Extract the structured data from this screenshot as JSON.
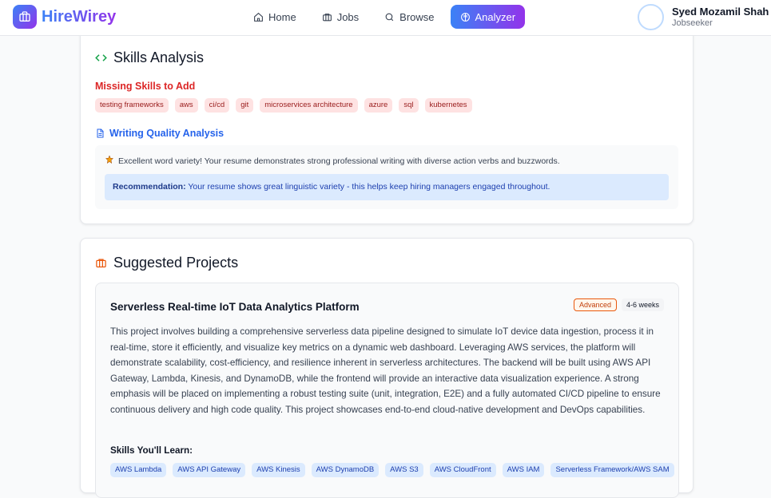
{
  "brand": {
    "name": "HireWirey"
  },
  "nav": {
    "items": [
      {
        "label": "Home",
        "icon": "home-icon"
      },
      {
        "label": "Jobs",
        "icon": "briefcase-icon"
      },
      {
        "label": "Browse",
        "icon": "search-icon"
      },
      {
        "label": "Analyzer",
        "icon": "brain-icon",
        "active": true
      }
    ]
  },
  "user": {
    "name": "Syed Mozamil Shah",
    "role": "Jobseeker"
  },
  "skills": {
    "title": "Skills Analysis",
    "missing_title": "Missing Skills to Add",
    "missing": [
      "testing frameworks",
      "aws",
      "ci/cd",
      "git",
      "microservices architecture",
      "azure",
      "sql",
      "kubernetes"
    ],
    "writing_title": "Writing Quality Analysis",
    "writing_text": "Excellent word variety! Your resume demonstrates strong professional writing with diverse action verbs and buzzwords.",
    "recommendation_label": "Recommendation:",
    "recommendation_text": "Your resume shows great linguistic variety - this helps keep hiring managers engaged throughout."
  },
  "projects": {
    "title": "Suggested Projects",
    "items": [
      {
        "title": "Serverless Real-time IoT Data Analytics Platform",
        "level": "Advanced",
        "duration": "4-6 weeks",
        "description": "This project involves building a comprehensive serverless data pipeline designed to simulate IoT device data ingestion, process it in real-time, store it efficiently, and visualize key metrics on a dynamic web dashboard. Leveraging AWS services, the platform will demonstrate scalability, cost-efficiency, and resilience inherent in serverless architectures. The backend will be built using AWS API Gateway, Lambda, Kinesis, and DynamoDB, while the frontend will provide an interactive data visualization experience. A strong emphasis will be placed on implementing a robust testing suite (unit, integration, E2E) and a fully automated CI/CD pipeline to ensure continuous delivery and high code quality. This project showcases end-to-end cloud-native development and DevOps capabilities.",
        "learn_title": "Skills You'll Learn:",
        "skills": [
          "AWS Lambda",
          "AWS API Gateway",
          "AWS Kinesis",
          "AWS DynamoDB",
          "AWS S3",
          "AWS CloudFront",
          "AWS IAM",
          "Serverless Framework/AWS SAM"
        ]
      }
    ]
  },
  "colors": {
    "accent_start": "#3b82f6",
    "accent_end": "#9333ea",
    "missing": "#dc2626",
    "link": "#2563eb"
  }
}
